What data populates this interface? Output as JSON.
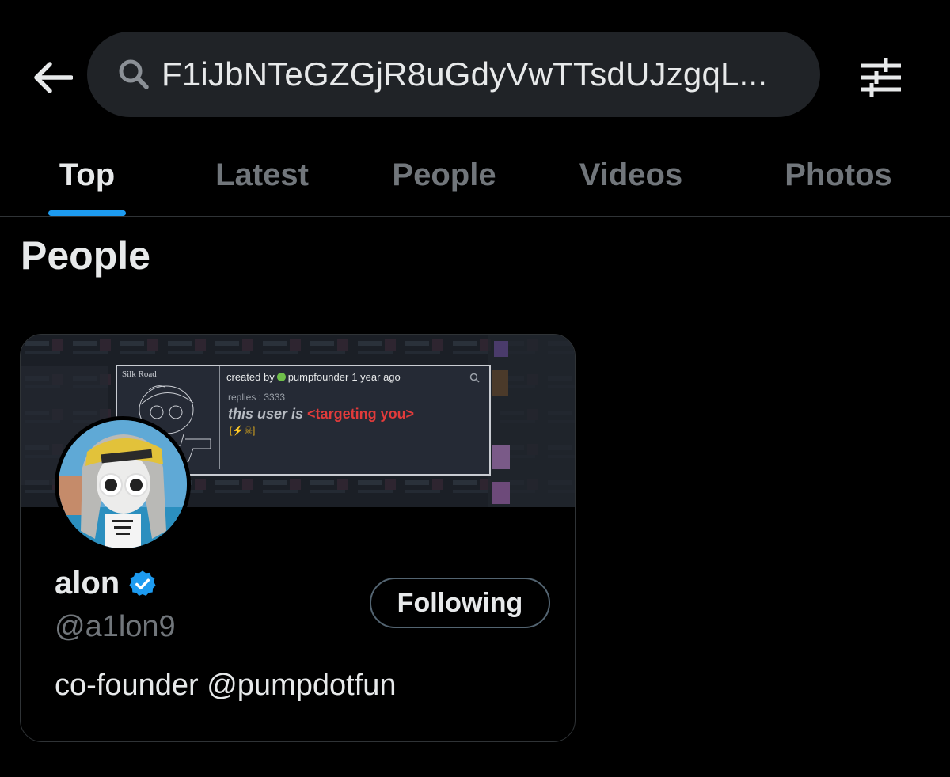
{
  "colors": {
    "background": "#000000",
    "search_bg": "#202327",
    "accent": "#1d9bf0",
    "muted_text": "#71767b",
    "primary_text": "#e7e9ea",
    "border": "#2f3336",
    "thread_red": "#e23b3b"
  },
  "header": {
    "back_icon": "arrow-left-icon",
    "search": {
      "icon": "search-icon",
      "query": "F1iJbNTeGZGjR8uGdyVwTTsdUJzgqL..."
    },
    "filter_icon": "sliders-icon"
  },
  "tabs": [
    {
      "label": "Top",
      "active": true
    },
    {
      "label": "Latest",
      "active": false
    },
    {
      "label": "People",
      "active": false
    },
    {
      "label": "Videos",
      "active": false
    },
    {
      "label": "Photos",
      "active": false
    }
  ],
  "section": {
    "title": "People"
  },
  "profile_card": {
    "banner": {
      "art_label": "Silk Road",
      "created_by_prefix": "created by",
      "created_by_user": "pumpfounder",
      "created_ago": "1 year ago",
      "replies": "replies : 3333",
      "line_prefix": "this user is ",
      "line_highlight": "<targeting you>",
      "icons": "[⚡☠]"
    },
    "avatar": "profile-avatar",
    "display_name": "alon",
    "verified": true,
    "handle": "@a1lon9",
    "bio": "co-founder @pumpdotfun",
    "follow_button": "Following"
  }
}
